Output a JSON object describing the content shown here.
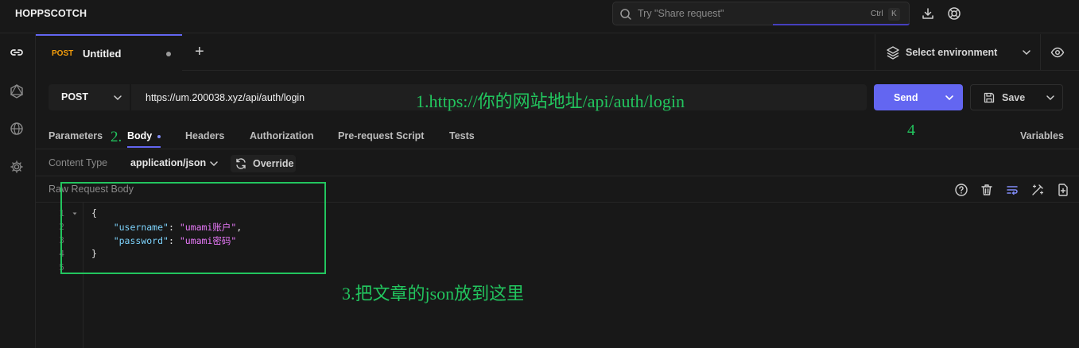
{
  "app": {
    "brand": "HOPPSCOTCH"
  },
  "search": {
    "placeholder": "Try \"Share request\"",
    "kbd_ctrl": "Ctrl",
    "kbd_k": "K"
  },
  "tab": {
    "method": "POST",
    "title": "Untitled",
    "add": "+"
  },
  "environment": {
    "label": "Select environment"
  },
  "request": {
    "method": "POST",
    "url": "https://um.200038.xyz/api/auth/login"
  },
  "actions": {
    "send": "Send",
    "save": "Save"
  },
  "request_tabs": {
    "parameters": "Parameters",
    "body": "Body",
    "headers": "Headers",
    "authorization": "Authorization",
    "prerequest": "Pre-request Script",
    "tests": "Tests",
    "variables": "Variables"
  },
  "content_type": {
    "label": "Content Type",
    "value": "application/json",
    "override": "Override"
  },
  "body": {
    "label": "Raw Request Body",
    "line_numbers": [
      "1",
      "2",
      "3",
      "4",
      "5"
    ],
    "open_brace": "{",
    "close_brace": "}",
    "username_key": "\"username\"",
    "username_value": "\"umami账户\"",
    "password_key": "\"password\"",
    "password_value": "\"umami密码\""
  },
  "annotations": {
    "step1": "1.https://你的网站地址/api/auth/login",
    "step2": "2.",
    "step3": "3.把文章的json放到这里",
    "step4": "4"
  },
  "colors": {
    "accent": "#6366f1",
    "annotation": "#22c55e",
    "method": "#f59e0b"
  }
}
